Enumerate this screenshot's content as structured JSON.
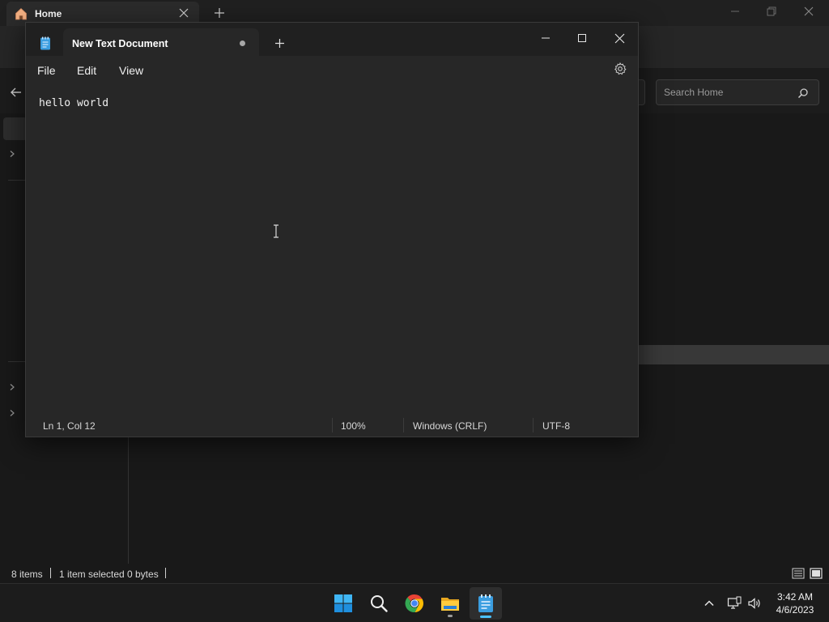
{
  "explorer": {
    "tab_title": "Home",
    "search_placeholder": "Search Home",
    "status": {
      "item_count": "8 items",
      "selection": "1 item selected",
      "size": "0 bytes"
    }
  },
  "notepad": {
    "tab_title": "New Text Document",
    "menu": [
      "File",
      "Edit",
      "View"
    ],
    "content": "hello world",
    "status": {
      "position": "Ln 1, Col 12",
      "zoom": "100%",
      "line_ending": "Windows (CRLF)",
      "encoding": "UTF-8"
    }
  },
  "taskbar": {
    "apps": [
      "start-icon",
      "search-icon",
      "chrome-icon",
      "file-explorer-icon",
      "notepad-icon"
    ],
    "clock": {
      "time": "3:42 AM",
      "date": "4/6/2023"
    }
  },
  "colors": {
    "accent": "#4cc2ff",
    "window_bg": "#272727",
    "titlebar_bg": "#202020"
  }
}
